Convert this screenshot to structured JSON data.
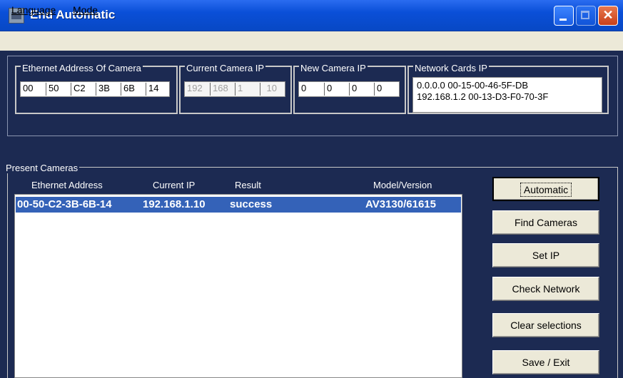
{
  "window": {
    "title": "End Automatic"
  },
  "menu": {
    "items": [
      "Language",
      "Mode"
    ]
  },
  "groups": {
    "ethernet": {
      "title": "Ethernet Address Of Camera",
      "cells": [
        "00",
        "50",
        "C2",
        "3B",
        "6B",
        "14"
      ]
    },
    "current_ip": {
      "title": "Current Camera IP",
      "cells": [
        "192",
        "168",
        "1",
        "10"
      ]
    },
    "new_ip": {
      "title": "New Camera IP",
      "cells": [
        "0",
        "0",
        "0",
        "0"
      ]
    },
    "network_cards": {
      "title": "Network Cards IP",
      "lines": [
        "0.0.0.0  00-15-00-46-5F-DB",
        "192.168.1.2  00-13-D3-F0-70-3F"
      ]
    }
  },
  "present": {
    "title": "Present Cameras",
    "columns": [
      "Ethernet Address",
      "Current IP",
      "Result",
      "Model/Version"
    ],
    "rows": [
      {
        "ethernet": "00-50-C2-3B-6B-14",
        "ip": "192.168.1.10",
        "result": "success",
        "model": "AV3130/61615"
      }
    ]
  },
  "buttons": [
    "Automatic",
    "Find Cameras",
    "Set IP",
    "Check Network",
    "Clear selections",
    "Save / Exit"
  ],
  "colors": {
    "background": "#1c2a52",
    "titlebar": "#0a4fd8",
    "selection": "#3462b8",
    "menubar": "#ece9d8"
  }
}
